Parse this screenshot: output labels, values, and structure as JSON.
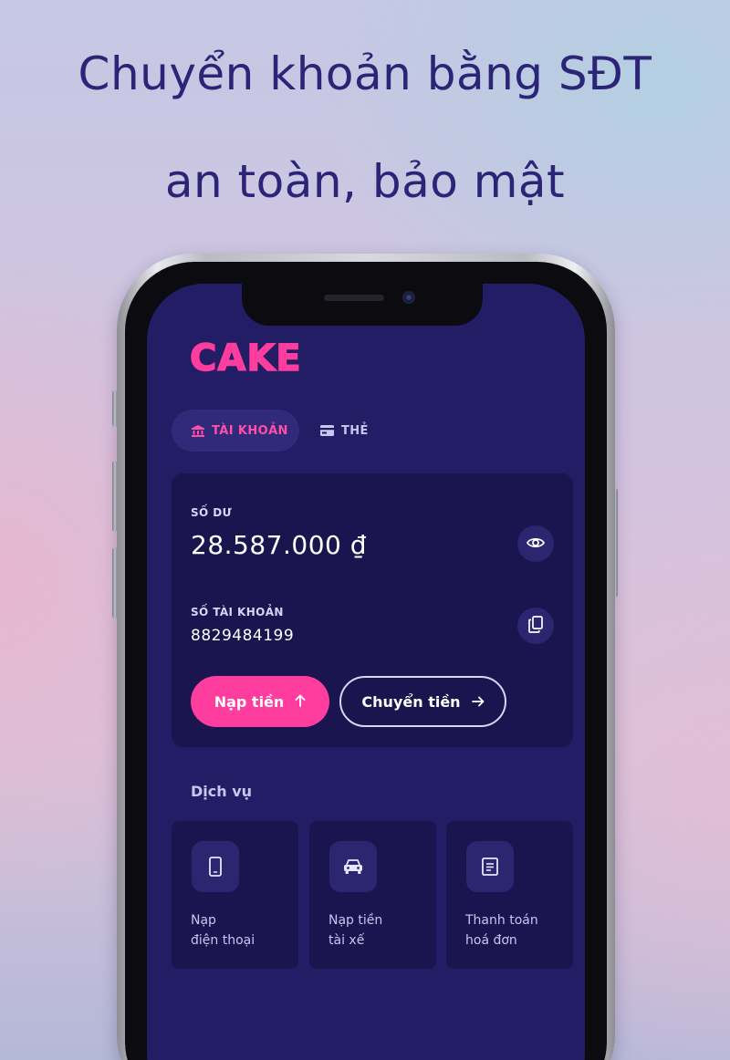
{
  "headline": {
    "line1": "Chuyển khoản bằng SĐT",
    "line2": "an toàn, bảo mật"
  },
  "app": {
    "logo": "CAKE",
    "tabs": [
      {
        "label": "TÀI KHOẢN",
        "icon": "bank-icon",
        "active": true
      },
      {
        "label": "THẺ",
        "icon": "card-icon",
        "active": false
      }
    ],
    "balance": {
      "label": "SỐ DƯ",
      "value": "28.587.000 ₫",
      "toggle_icon": "eye-icon"
    },
    "account": {
      "label": "SỐ TÀI KHOẢN",
      "number": "8829484199",
      "copy_icon": "copy-icon"
    },
    "actions": {
      "deposit_label": "Nạp tiền",
      "deposit_icon": "arrow-up-icon",
      "transfer_label": "Chuyển tiền",
      "transfer_icon": "arrow-right-icon"
    },
    "services": {
      "title": "Dịch vụ",
      "items": [
        {
          "label": "Nạp\nđiện thoại",
          "icon": "phone-icon"
        },
        {
          "label": "Nạp tiền\ntài xế",
          "icon": "car-icon"
        },
        {
          "label": "Thanh toán\nhoá đơn",
          "icon": "bill-icon"
        }
      ]
    }
  },
  "colors": {
    "accent": "#ff3d9e",
    "screen_bg": "#231d65",
    "card_bg": "#1a144f",
    "headline": "#2c2476"
  }
}
